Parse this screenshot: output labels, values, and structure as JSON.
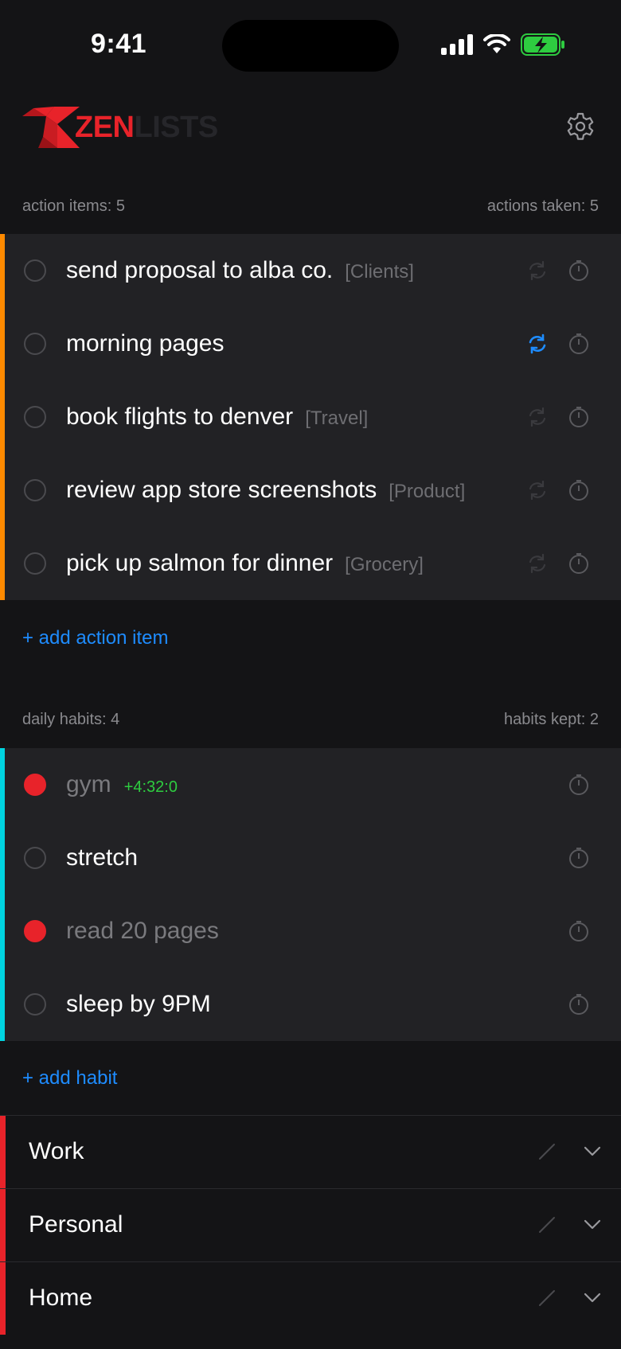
{
  "status_bar": {
    "time": "9:41"
  },
  "header": {
    "logo_zen": "ZEN",
    "logo_lists": "LISTS"
  },
  "action_section": {
    "left_label": "action items: 5",
    "right_label": "actions taken: 5",
    "accent_color": "#ff8a00",
    "items": [
      {
        "title": "send proposal to alba co.",
        "tag": "[Clients]",
        "repeat_active": false
      },
      {
        "title": "morning pages",
        "tag": "",
        "repeat_active": true
      },
      {
        "title": "book flights to denver",
        "tag": "[Travel]",
        "repeat_active": false
      },
      {
        "title": "review app store screenshots",
        "tag": "[Product]",
        "repeat_active": false
      },
      {
        "title": "pick up salmon for dinner",
        "tag": "[Grocery]",
        "repeat_active": false
      }
    ],
    "add_label": "+ add action item"
  },
  "habit_section": {
    "left_label": "daily habits: 4",
    "right_label": "habits kept: 2",
    "accent_color": "#00d4e0",
    "items": [
      {
        "title": "gym",
        "badge": "+4:32:0",
        "done": true
      },
      {
        "title": "stretch",
        "badge": "",
        "done": false
      },
      {
        "title": "read 20 pages",
        "badge": "",
        "done": true
      },
      {
        "title": "sleep by 9PM",
        "badge": "",
        "done": false
      }
    ],
    "add_label": "+ add habit"
  },
  "folders": [
    {
      "name": "Work"
    },
    {
      "name": "Personal"
    },
    {
      "name": "Home"
    }
  ],
  "colors": {
    "background": "#141416",
    "row_background": "#222225",
    "link_blue": "#1e8cff",
    "brand_red": "#e8232a",
    "timer_green": "#2ecc40"
  }
}
